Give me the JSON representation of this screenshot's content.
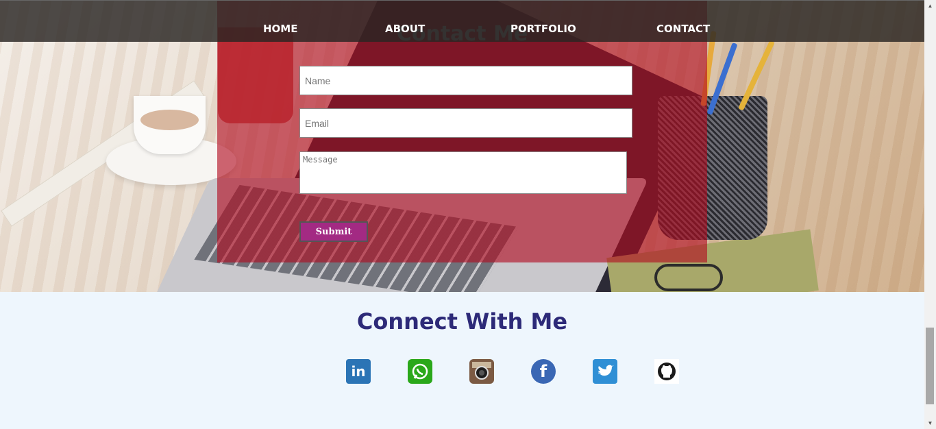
{
  "nav": {
    "items": [
      {
        "label": "HOME"
      },
      {
        "label": "ABOUT"
      },
      {
        "label": "PORTFOLIO"
      },
      {
        "label": "CONTACT"
      }
    ]
  },
  "contact": {
    "title": "Contact Me",
    "name_placeholder": "Name",
    "email_placeholder": "Email",
    "message_placeholder": "Message",
    "submit_label": "Submit"
  },
  "connect": {
    "title": "Connect With Me",
    "icons": [
      "linkedin-icon",
      "whatsapp-icon",
      "instagram-icon",
      "facebook-icon",
      "twitter-icon",
      "github-icon"
    ]
  },
  "colors": {
    "overlay": "#b20a1e",
    "nav_bg": "#282422",
    "submit_bg": "#a32a83",
    "connect_title": "#2d2a78",
    "footer_bg": "#eef6fd"
  }
}
